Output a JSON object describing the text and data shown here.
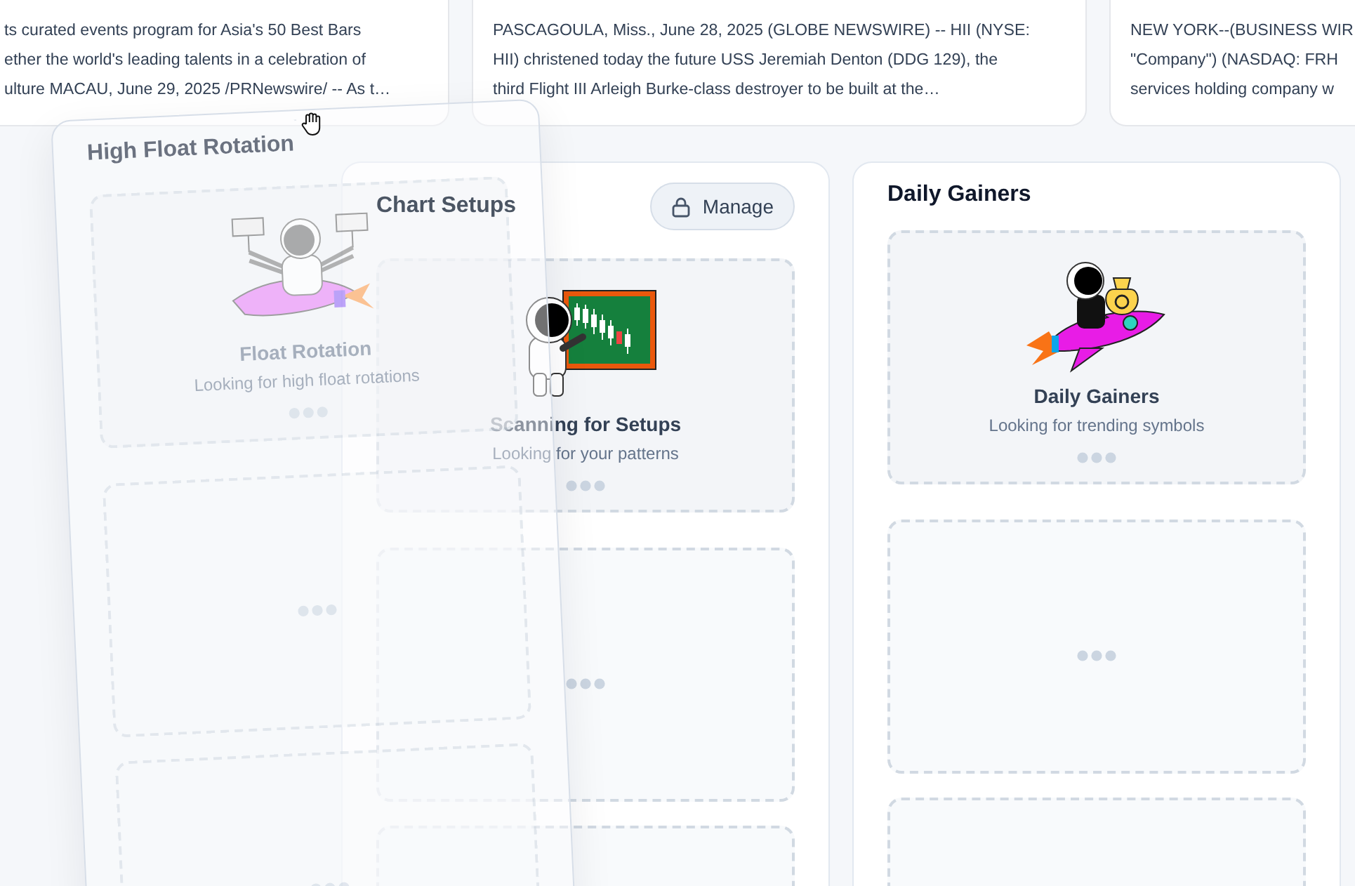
{
  "news": [
    {
      "lines": [
        "ts curated events program for Asia's 50 Best Bars",
        "ether the world's leading talents in a celebration of",
        "ulture MACAU, June 29, 2025 /PRNewswire/ -- As t…"
      ]
    },
    {
      "lines": [
        "PASCAGOULA, Miss., June 28, 2025 (GLOBE NEWSWIRE) -- HII (NYSE:",
        "HII) christened today the future USS Jeremiah Denton (DDG 129), the",
        "third Flight III Arleigh Burke-class destroyer to be built at the…"
      ]
    },
    {
      "lines": [
        "NEW YORK--(BUSINESS WIR",
        "\"Company\") (NASDAQ: FRH",
        "services holding company w"
      ]
    }
  ],
  "dragged_widget": {
    "title": "High Float Rotation",
    "slots": [
      {
        "kind": "art",
        "title": "Float Rotation",
        "subtitle": "Looking for high float rotations"
      },
      {
        "kind": "empty"
      },
      {
        "kind": "empty"
      }
    ]
  },
  "columns": [
    {
      "title": "Chart Setups",
      "button": {
        "label": "Manage"
      },
      "slots": [
        {
          "kind": "art",
          "title": "Scanning for Setups",
          "subtitle": "Looking for your patterns"
        },
        {
          "kind": "empty"
        },
        {
          "kind": "empty"
        }
      ]
    },
    {
      "title": "Daily Gainers",
      "slots": [
        {
          "kind": "art",
          "title": "Daily Gainers",
          "subtitle": "Looking for trending symbols"
        },
        {
          "kind": "empty"
        },
        {
          "kind": "empty"
        }
      ]
    }
  ]
}
